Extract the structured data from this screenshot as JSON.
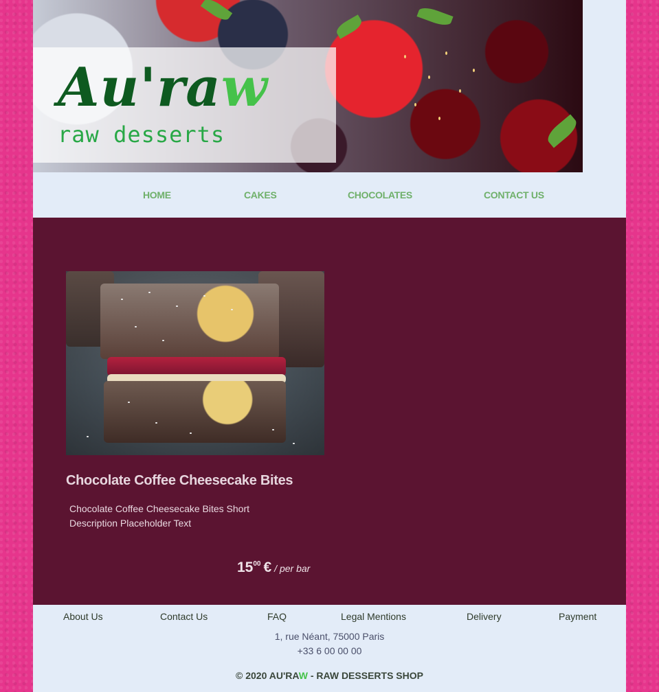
{
  "brand": {
    "logo_main": "Au'ra",
    "logo_w": "w",
    "tagline": "raw desserts"
  },
  "nav": {
    "items": [
      "HOME",
      "CAKES",
      "CHOCOLATES",
      "CONTACT US"
    ]
  },
  "product": {
    "title": "Chocolate Coffee Cheesecake Bites",
    "description": "Chocolate Coffee Cheesecake Bites Short Description Placeholder Text",
    "price_int": "15",
    "price_dec": "00",
    "currency": "€",
    "unit": "/ per bar"
  },
  "footer": {
    "links": [
      "About Us",
      "Contact Us",
      "FAQ",
      "Legal Mentions",
      "Delivery",
      "Payment"
    ],
    "address": "1, rue Néant, 75000 Paris",
    "phone": "+33 6 00 00 00",
    "copyright_pre": "© 2020 AU'RA",
    "copyright_w": "W",
    "copyright_post": " - RAW DESSERTS SHOP"
  },
  "colors": {
    "background_pink": "#e6358c",
    "main_maroon": "#5b1431",
    "page_light": "#e3ecf8",
    "brand_green": "#0e5a20",
    "accent_green": "#45c24a"
  }
}
